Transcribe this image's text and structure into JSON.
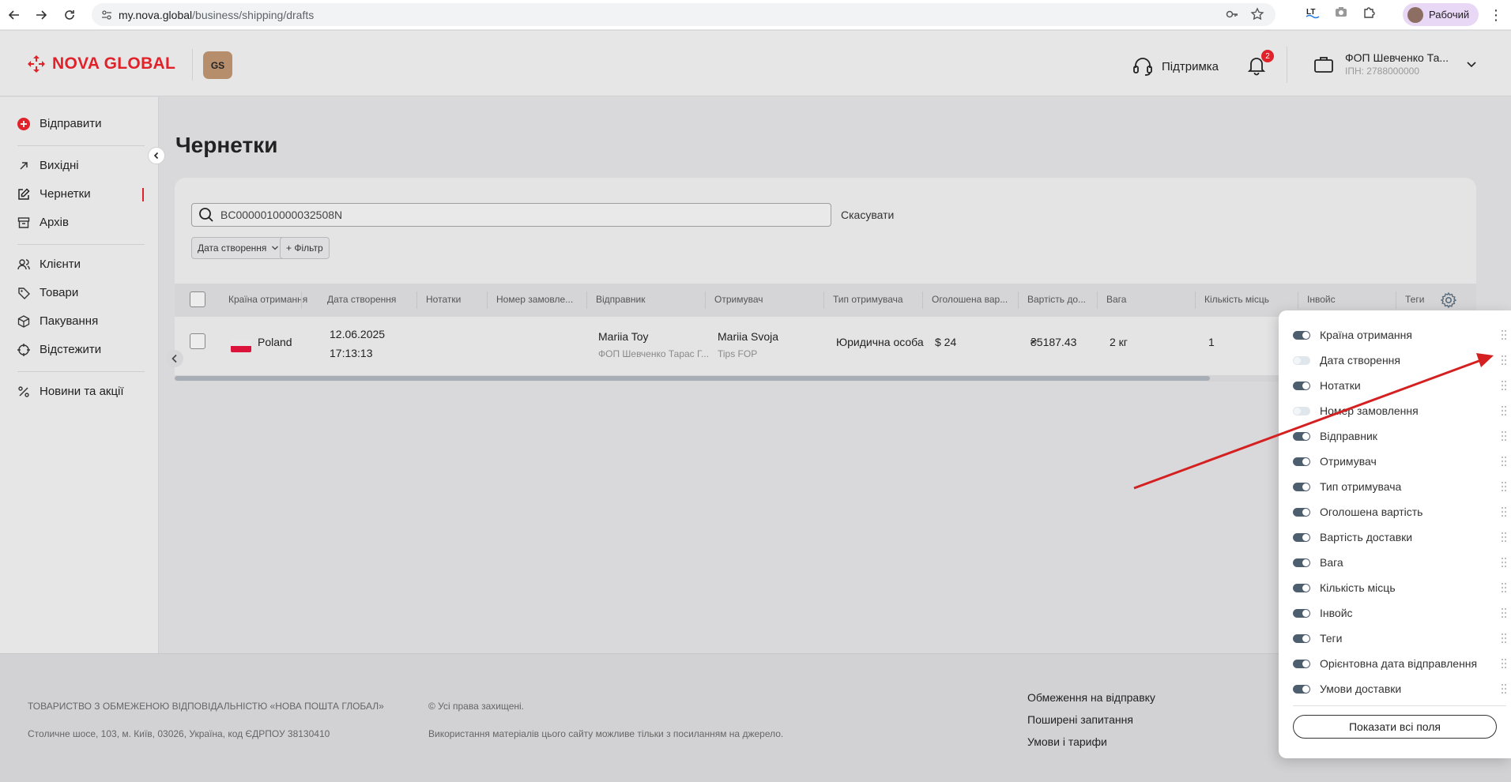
{
  "browser": {
    "url_host": "my.nova.global",
    "url_path": "/business/shipping/drafts",
    "profile_label": "Рабочий"
  },
  "header": {
    "logo_text": "NOVA GLOBAL",
    "badge_text": "GS",
    "support_label": "Підтримка",
    "notifications_count": "2",
    "account_name": "ФОП Шевченко Та...",
    "account_inn": "ІПН: 2788000000"
  },
  "sidebar": {
    "send_label": "Відправити",
    "items": [
      {
        "label": "Вихідні"
      },
      {
        "label": "Чернетки"
      },
      {
        "label": "Архів"
      },
      {
        "label": "Клієнти"
      },
      {
        "label": "Товари"
      },
      {
        "label": "Пакування"
      },
      {
        "label": "Відстежити"
      },
      {
        "label": "Новини та акції"
      }
    ]
  },
  "page": {
    "title": "Чернетки",
    "search_value": "BC0000010000032508N",
    "cancel_label": "Скасувати",
    "filter_date_label": "Дата створення",
    "filter_add_label": "+ Фільтр"
  },
  "table": {
    "headers": [
      "Країна отримання",
      "Дата створення",
      "Нотатки",
      "Номер замовле...",
      "Відправник",
      "Отримувач",
      "Тип отримувача",
      "Оголошена вар...",
      "Вартість до...",
      "Вага",
      "Кількість місць",
      "Інвойс",
      "Теги"
    ],
    "row": {
      "country": "Poland",
      "date": "12.06.2025",
      "time": "17:13:13",
      "sender_name": "Mariia Toy",
      "sender_company": "ФОП Шевченко Тарас Г...",
      "receiver_name": "Mariia Svoja",
      "receiver_company": "Tips FOP",
      "receiver_type": "Юридична особа",
      "declared_value": "$ 24",
      "delivery_cost": "₴5187.43",
      "weight": "2 кг",
      "places": "1"
    }
  },
  "columns_panel": {
    "items": [
      {
        "label": "Країна отримання",
        "enabled": true
      },
      {
        "label": "Дата створення",
        "enabled": false
      },
      {
        "label": "Нотатки",
        "enabled": true
      },
      {
        "label": "Номер замовлення",
        "enabled": false
      },
      {
        "label": "Відправник",
        "enabled": true
      },
      {
        "label": "Отримувач",
        "enabled": true
      },
      {
        "label": "Тип отримувача",
        "enabled": true
      },
      {
        "label": "Оголошена вартість",
        "enabled": true
      },
      {
        "label": "Вартість доставки",
        "enabled": true
      },
      {
        "label": "Вага",
        "enabled": true
      },
      {
        "label": "Кількість місць",
        "enabled": true
      },
      {
        "label": "Інвойс",
        "enabled": true
      },
      {
        "label": "Теги",
        "enabled": true
      },
      {
        "label": "Орієнтовна дата відправлення",
        "enabled": true
      },
      {
        "label": "Умови доставки",
        "enabled": true
      }
    ],
    "show_all_label": "Показати всі поля"
  },
  "footer": {
    "company": "ТОВАРИСТВО З ОБМЕЖЕНОЮ ВІДПОВІДАЛЬНІСТЮ «НОВА ПОШТА ГЛОБАЛ»",
    "address": "Столичне шосе, 103, м. Київ, 03026, Україна, код ЄДРПОУ 38130410",
    "rights": "© Усі права захищені.",
    "usage": "Використання матеріалів цього сайту можливе тільки з посиланням на джерело.",
    "links": [
      "Обмеження на відправку",
      "Поширені запитання",
      "Умови і тарифи"
    ]
  },
  "colors": {
    "brand_red": "#e0222a",
    "toggle_on": "#4d5f6e",
    "toggle_off": "#dfe6ec"
  }
}
